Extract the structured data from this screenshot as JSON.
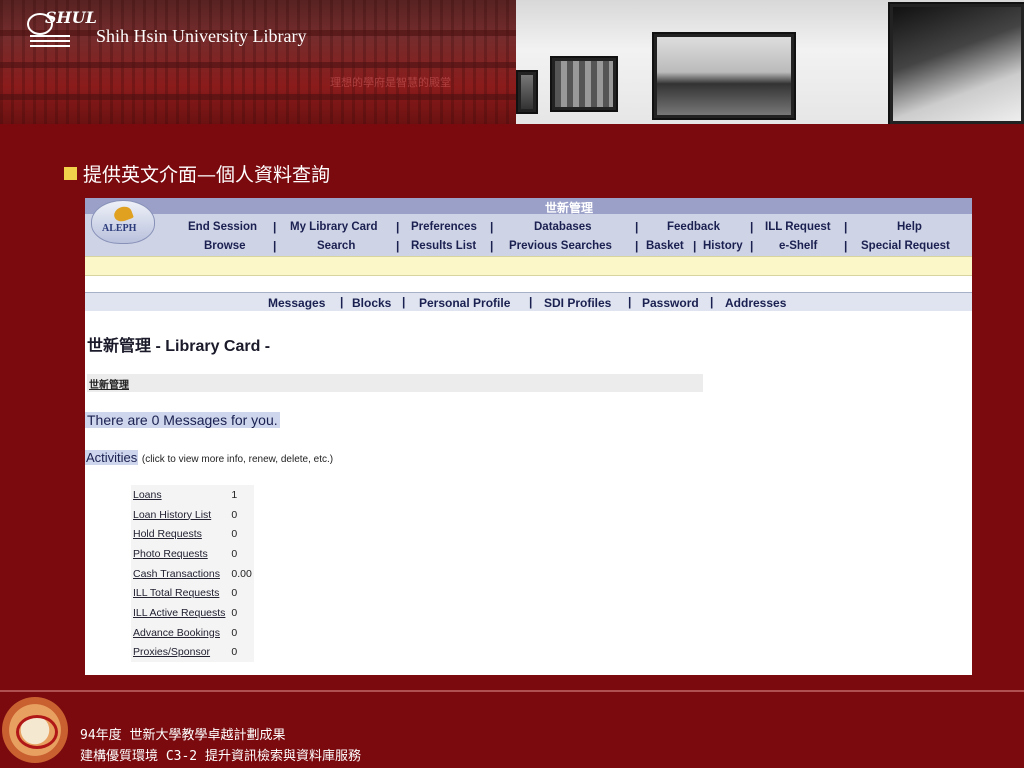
{
  "banner": {
    "logo_text": "SHUL",
    "library_name": "Shih Hsin University Library",
    "caption": "理想的學府是智慧的殿堂"
  },
  "slide": {
    "heading": "提供英文介面—個人資料查詢"
  },
  "aleph": {
    "system_title": "世新管理",
    "logo_text": "ALEPH",
    "nav_row1": [
      "End Session",
      "My Library Card",
      "Preferences",
      "Databases",
      "Feedback",
      "ILL Request",
      "Help"
    ],
    "nav_row2": [
      "Browse",
      "Search",
      "Results List",
      "Previous Searches",
      "Basket",
      "History",
      "e-Shelf",
      "Special Request"
    ],
    "sub_nav": [
      "Messages",
      "Blocks",
      "Personal Profile",
      "SDI Profiles",
      "Password",
      "Addresses"
    ],
    "page_title": "世新管理 - Library Card -",
    "card_label": "世新管理",
    "messages_text": "There are 0 Messages for you.",
    "activities_label": "Activities",
    "activities_hint": "(click to view more info, renew, delete, etc.)",
    "activities": [
      {
        "label": "Loans",
        "value": "1"
      },
      {
        "label": "Loan History List",
        "value": "0"
      },
      {
        "label": "Hold Requests",
        "value": "0"
      },
      {
        "label": "Photo Requests",
        "value": "0"
      },
      {
        "label": "Cash Transactions",
        "value": "0.00"
      },
      {
        "label": "ILL Total Requests",
        "value": "0"
      },
      {
        "label": "ILL Active Requests",
        "value": "0"
      },
      {
        "label": "Advance Bookings",
        "value": "0"
      },
      {
        "label": "Proxies/Sponsor",
        "value": "0"
      }
    ]
  },
  "footer": {
    "line1": "94年度 世新大學教學卓越計劃成果",
    "line2": "建構優質環境 C3-2 提升資訊檢索與資料庫服務"
  },
  "colors": {
    "background": "#7a0a0e",
    "bullet": "#f2d24a",
    "nav_text": "#1a2050",
    "highlight": "#cdd6ec"
  }
}
